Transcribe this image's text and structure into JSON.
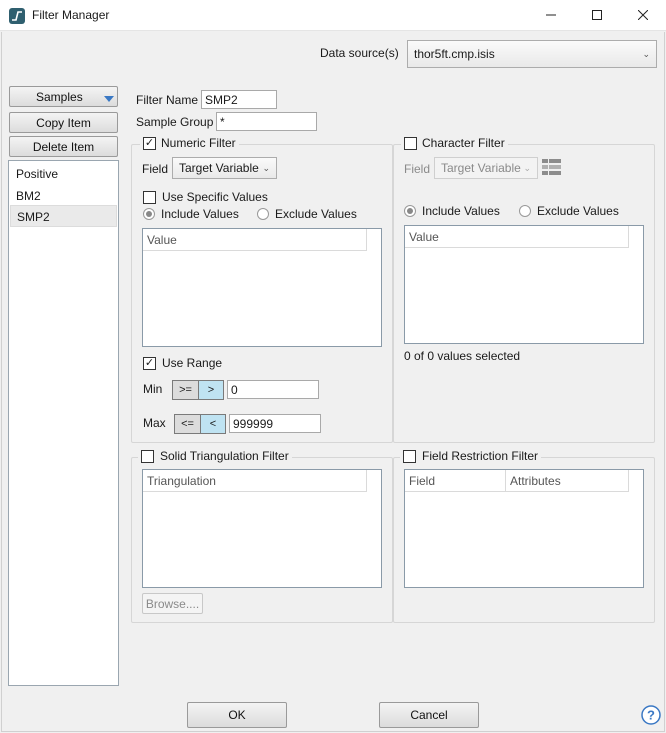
{
  "window": {
    "title": "Filter Manager",
    "minimize_icon": "minimize-icon",
    "maximize_icon": "maximize-icon",
    "close_icon": "close-icon"
  },
  "data_source": {
    "label": "Data source(s)",
    "value": "thor5ft.cmp.isis"
  },
  "left": {
    "type_dropdown": "Samples",
    "copy_item": "Copy Item",
    "delete_item": "Delete Item",
    "items": [
      "Positive",
      "BM2",
      "SMP2"
    ],
    "selected_index": 2
  },
  "filter_name": {
    "label": "Filter Name",
    "value": "SMP2"
  },
  "sample_group": {
    "label": "Sample Group",
    "value": "*"
  },
  "numeric": {
    "title": "Numeric Filter",
    "checked": true,
    "field_label": "Field",
    "field_value": "Target Variable",
    "use_specific": "Use Specific Values",
    "include": "Include Values",
    "exclude": "Exclude Values",
    "value_header": "Value",
    "use_range": "Use Range",
    "min_label": "Min",
    "min_ops": [
      ">=",
      ">"
    ],
    "min_value": "0",
    "max_label": "Max",
    "max_ops": [
      "<=",
      "<"
    ],
    "max_value": "999999"
  },
  "character": {
    "title": "Character Filter",
    "field_label": "Field",
    "field_value": "Target Variable",
    "include": "Include Values",
    "exclude": "Exclude Values",
    "value_header": "Value",
    "status": "0 of 0 values selected"
  },
  "triangulation": {
    "title": "Solid Triangulation Filter",
    "header": "Triangulation",
    "browse": "Browse...."
  },
  "field_restriction": {
    "title": "Field Restriction Filter",
    "col_field": "Field",
    "col_attributes": "Attributes"
  },
  "footer": {
    "ok": "OK",
    "cancel": "Cancel",
    "help_icon": "help-icon"
  }
}
